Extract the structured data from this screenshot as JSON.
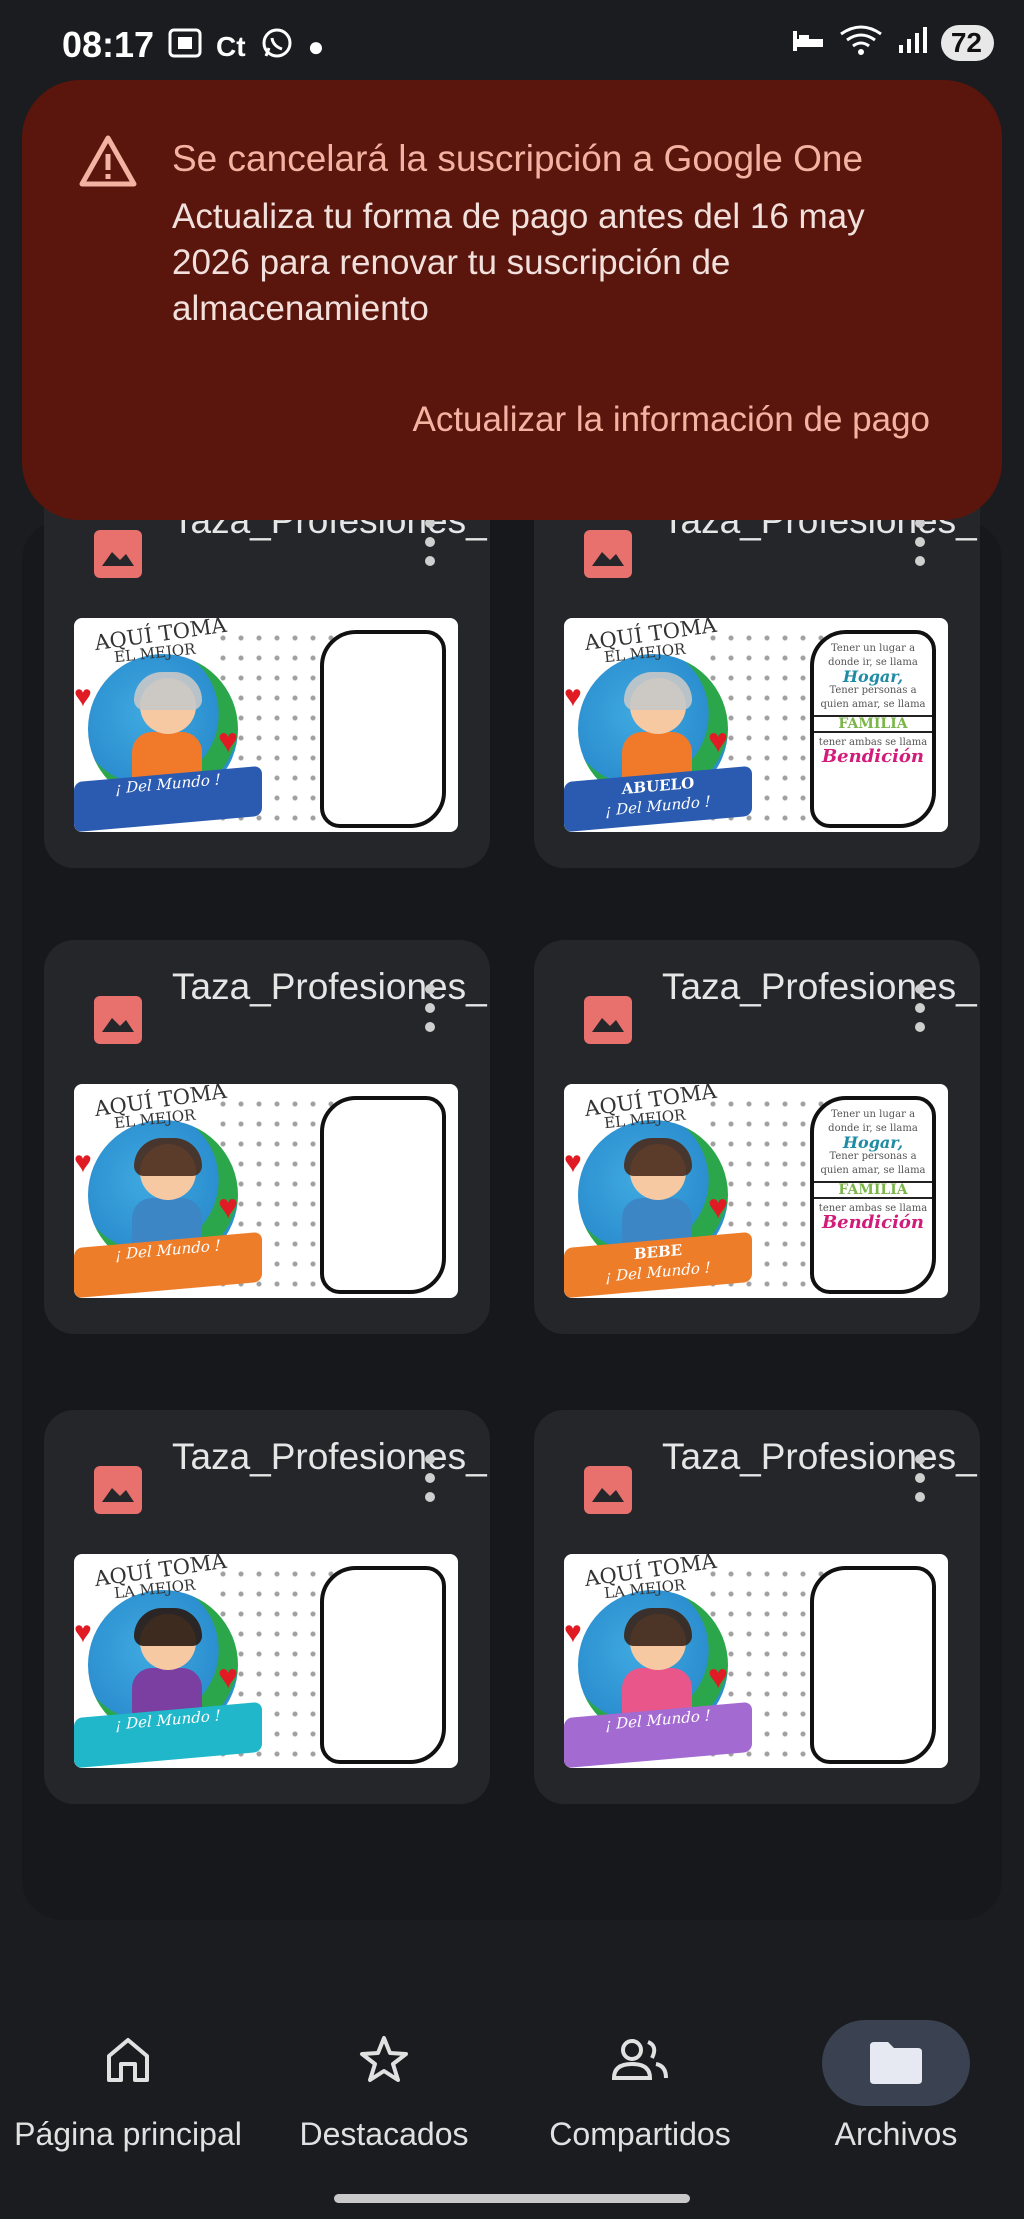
{
  "status_bar": {
    "time": "08:17",
    "battery": "72",
    "left_icons": [
      "screenshot-icon",
      "ct-icon",
      "whatsapp-icon",
      "dot-icon"
    ],
    "right_icons": [
      "sleep-icon",
      "wifi-icon",
      "signal-icon"
    ]
  },
  "banner": {
    "title": "Se cancelará la suscripción a Google One",
    "message": "Actualiza tu forma de pago antes del 16 may 2026 para renovar tu suscripción de almacenamiento",
    "action": "Actualizar la información de pago",
    "bg_color": "#5a150c",
    "accent_color": "#f3b3a3"
  },
  "files": [
    {
      "name": "Taza_Profesiones_...",
      "thumb_title": "AQUÍ TOMA",
      "thumb_sub": "EL MEJOR",
      "banner_text": "",
      "banner_text2": "¡ Del Mundo !",
      "banner_color": "#2a5bb0",
      "shirt": "#f07a2a",
      "hair": "#c8c8c8",
      "frame_text": false
    },
    {
      "name": "Taza_Profesiones_...",
      "thumb_title": "AQUÍ TOMA",
      "thumb_sub": "EL MEJOR",
      "banner_text": "ABUELO",
      "banner_text2": "¡ Del Mundo !",
      "banner_color": "#2a5bb0",
      "shirt": "#f07a2a",
      "hair": "#c8c8c8",
      "frame_text": true
    },
    {
      "name": "Taza_Profesiones_...",
      "thumb_title": "AQUÍ TOMA",
      "thumb_sub": "EL MEJOR",
      "banner_text": "",
      "banner_text2": "¡ Del Mundo !",
      "banner_color": "#ee7d2a",
      "shirt": "#3d86c6",
      "hair": "#4a2b1c",
      "frame_text": false
    },
    {
      "name": "Taza_Profesiones_...",
      "thumb_title": "AQUÍ TOMA",
      "thumb_sub": "EL MEJOR",
      "banner_text": "BEBE",
      "banner_text2": "¡ Del Mundo !",
      "banner_color": "#ee7d2a",
      "shirt": "#3d86c6",
      "hair": "#4a2b1c",
      "frame_text": true
    },
    {
      "name": "Taza_Profesiones_...",
      "thumb_title": "AQUÍ TOMA",
      "thumb_sub": "LA MEJOR",
      "banner_text": "",
      "banner_text2": "¡ Del Mundo !",
      "banner_color": "#1fb7c9",
      "shirt": "#7a3fa0",
      "hair": "#2a1a12",
      "frame_text": false
    },
    {
      "name": "Taza_Profesiones_...",
      "thumb_title": "AQUÍ TOMA",
      "thumb_sub": "LA MEJOR",
      "banner_text": "",
      "banner_text2": "¡ Del Mundo !",
      "banner_color": "#a36bd2",
      "shirt": "#e8568a",
      "hair": "#3a2418",
      "frame_text": false
    }
  ],
  "frame_text": {
    "line1": "Tener un lugar a donde ir, se llama",
    "hogar": "Hogar,",
    "line2": "Tener personas a quien amar, se llama",
    "familia": "FAMILIA",
    "line3": "tener ambas se llama",
    "bendicion": "Bendición"
  },
  "nav": {
    "items": [
      {
        "label": "Página principal",
        "icon": "home-icon",
        "active": false
      },
      {
        "label": "Destacados",
        "icon": "star-icon",
        "active": false
      },
      {
        "label": "Compartidos",
        "icon": "people-icon",
        "active": false
      },
      {
        "label": "Archivos",
        "icon": "folder-icon",
        "active": true
      }
    ]
  }
}
